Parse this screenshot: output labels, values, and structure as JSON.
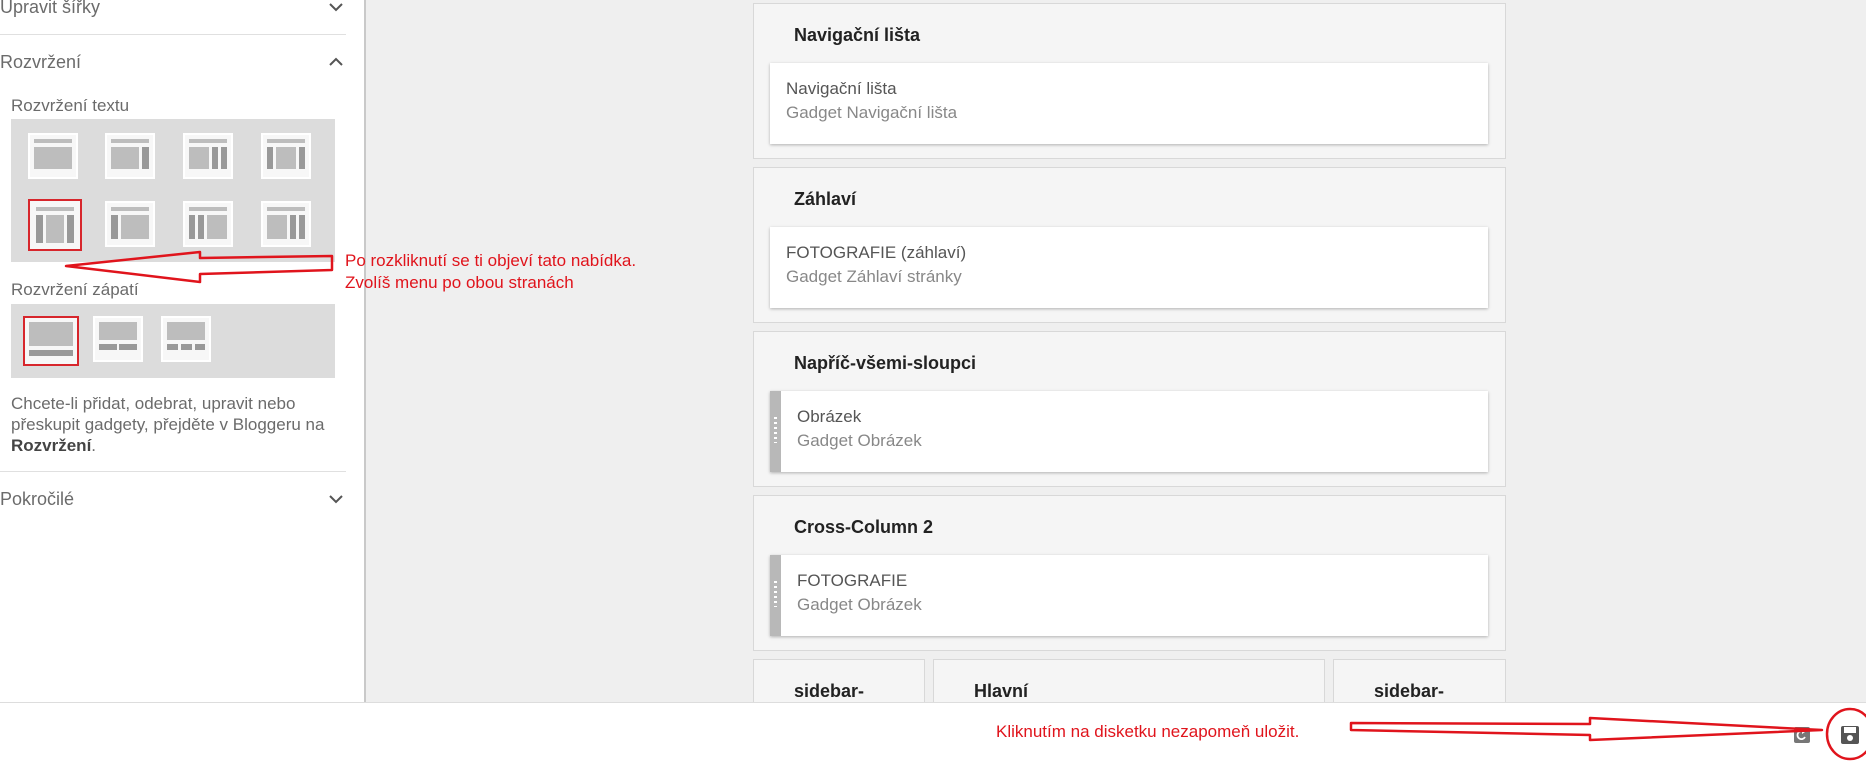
{
  "sidebar": {
    "section_widths": "Upravit šířky",
    "section_layout": "Rozvržení",
    "text_layout_label": "Rozvržení textu",
    "footer_layout_label": "Rozvržení zápatí",
    "help_text_1": "Chcete-li přidat, odebrat, upravit nebo přeskupit gadgety, přejděte v Bloggeru na ",
    "help_text_bold": "Rozvržení",
    "help_text_2": ".",
    "section_advanced": "Pokročilé"
  },
  "layout": {
    "sections": [
      {
        "title": "Navigační lišta",
        "gadget_name": "Navigační lišta",
        "gadget_type": "Gadget Navigační lišta"
      },
      {
        "title": "Záhlaví",
        "gadget_name": "FOTOGRAFIE (záhlaví)",
        "gadget_type": "Gadget Záhlaví stránky"
      },
      {
        "title": "Napříč-všemi-sloupci",
        "gadget_name": "Obrázek",
        "gadget_type": "Gadget Obrázek"
      },
      {
        "title": "Cross-Column 2",
        "gadget_name": "FOTOGRAFIE",
        "gadget_type": "Gadget Obrázek"
      }
    ],
    "bottom_columns": [
      "sidebar-",
      "Hlavní",
      "sidebar-"
    ]
  },
  "annotations": {
    "menu_line1": "Po rozkliknutí se ti objeví tato nabídka.",
    "menu_line2": "Zvolíš menu po obou stranách",
    "save_hint": "Kliknutím na disketku nezapomeň uložit."
  },
  "colors": {
    "annotation_red": "#e0141c",
    "selected_border": "#d7262c"
  },
  "icons": {
    "collapse": "chevron-down-icon",
    "expand": "chevron-up-icon",
    "revert": "revert-icon",
    "save": "floppy-disk-icon"
  }
}
